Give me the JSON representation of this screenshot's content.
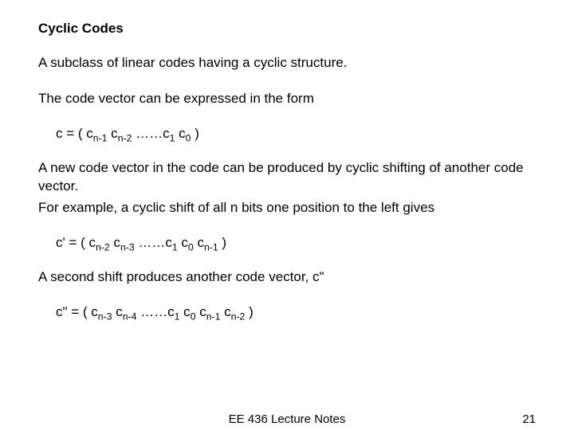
{
  "title": "Cyclic Codes",
  "p1": "A subclass of linear codes having a cyclic structure.",
  "p2": "The code vector can be expressed in the form",
  "eq1": {
    "lead": "c = ( c",
    "s1": "n-1",
    "mid1": "  c",
    "s2": "n-2",
    "mid2": "  ……c",
    "s3": "1",
    "mid3": " c",
    "s4": "0",
    "tail": " )"
  },
  "p3a": "A new code vector in the code can be produced by cyclic shifting of another code vector.",
  "p3b": "For example, a cyclic shift of all n bits one position to the left gives",
  "eq2": {
    "lead": "c' = ( c",
    "s1": "n-2",
    "mid1": "  c",
    "s2": "n-3",
    "mid2": "  ……c",
    "s3": "1",
    "mid3": " c",
    "s4": "0",
    "mid4": "  c",
    "s5": "n-1",
    "tail": " )"
  },
  "p4": "A second shift produces another code vector, c\"",
  "eq3": {
    "lead": "c\" = ( c",
    "s1": "n-3",
    "mid1": "  c",
    "s2": "n-4",
    "mid2": "  ……c",
    "s3": "1",
    "mid3": " c",
    "s4": "0",
    "mid4": "  c",
    "s5": "n-1",
    "mid5": " c",
    "s6": "n-2",
    "tail": " )"
  },
  "footer_center": "EE 436 Lecture Notes",
  "footer_right": "21"
}
